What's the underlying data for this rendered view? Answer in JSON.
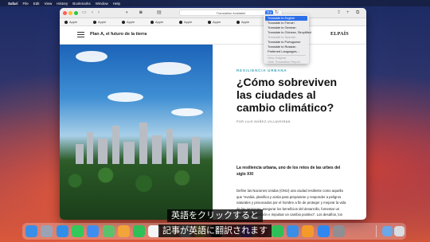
{
  "menubar": {
    "app": "Safari",
    "items": [
      "File",
      "Edit",
      "View",
      "History",
      "Bookmarks",
      "Window",
      "Help"
    ]
  },
  "toolbar": {
    "address": "Translation Available"
  },
  "favorites": [
    {
      "label": "Apple",
      "color": "#222222"
    },
    {
      "label": "Apple",
      "color": "#222222"
    },
    {
      "label": "Apple",
      "color": "#222222"
    },
    {
      "label": "Apple",
      "color": "#222222"
    },
    {
      "label": "Apple",
      "color": "#222222"
    },
    {
      "label": "Apple",
      "color": "#222222"
    },
    {
      "label": "Apple",
      "color": "#222222"
    },
    {
      "label": "Apple",
      "color": "#222222"
    },
    {
      "label": "Apple",
      "color": "#222222"
    }
  ],
  "site": {
    "section_title": "Plan A, el futuro de la tierra",
    "logo": "ELPAÍS"
  },
  "translate_menu": {
    "items": [
      {
        "label": "Translate to English",
        "state": "selected"
      },
      {
        "label": "Translate to French",
        "state": "normal"
      },
      {
        "label": "Translate to German",
        "state": "normal"
      },
      {
        "label": "Translate to Chinese, Simplified",
        "state": "normal"
      },
      {
        "label": "Translate to Spanish",
        "state": "disabled"
      },
      {
        "label": "Translate to Portuguese",
        "state": "normal"
      },
      {
        "label": "Translate to Russian",
        "state": "normal"
      },
      {
        "label": "Preferred Languages…",
        "state": "normal"
      },
      {
        "label": "View Original",
        "state": "disabled"
      },
      {
        "label": "Hide Translation Report",
        "state": "disabled"
      }
    ]
  },
  "article": {
    "kicker": "RESILIENCIA URBANA",
    "headline": "¿Cómo sobreviven las ciudades al cambio climático?",
    "byline": "POR LUIS NÚÑEZ-VILLAVEIRÁN",
    "lead": "La resiliencia urbana, uno de los retos de las urbes del siglo XXI",
    "body": "Define las Naciones Unidas (ONU) una ciudad resiliente como aquella que \"evalúa, planifica y actúa para prepararse y responder a peligros naturales y provocados por el hombre a fin de proteger y mejorar la vida de las personas, asegurar los beneficios del desarrollo, fomentar un entorno de inversión e impulsar un cambio positivo\". Los desafíos, los tenemos a día de hoy muy"
  },
  "subtitles": {
    "line1": "英語をクリックすると",
    "line2": "記事が英語に翻訳されます"
  },
  "dock": [
    {
      "icon": "finder-icon",
      "color": "#3a8ee6"
    },
    {
      "icon": "launchpad-icon",
      "color": "#9aa3b5"
    },
    {
      "icon": "safari-icon",
      "color": "#2f8fe8"
    },
    {
      "icon": "messages-icon",
      "color": "#34c759"
    },
    {
      "icon": "mail-icon",
      "color": "#3d8ef0"
    },
    {
      "icon": "maps-icon",
      "color": "#5cc16c"
    },
    {
      "icon": "photos-icon",
      "color": "#f2a33a"
    },
    {
      "icon": "facetime-icon",
      "color": "#2fbf58"
    },
    {
      "icon": "calendar-icon",
      "color": "#f5f5f5"
    },
    {
      "icon": "contacts-icon",
      "color": "#c9a07a"
    },
    {
      "icon": "reminders-icon",
      "color": "#f0f0f0"
    },
    {
      "icon": "notes-icon",
      "color": "#f7d54a"
    },
    {
      "icon": "tv-icon",
      "color": "#1e1e1e"
    },
    {
      "icon": "music-icon",
      "color": "#f04a5e"
    },
    {
      "icon": "podcasts-icon",
      "color": "#9b4de0"
    },
    {
      "icon": "news-icon",
      "color": "#f04b4b"
    },
    {
      "icon": "numbers-icon",
      "color": "#2fbf58"
    },
    {
      "icon": "keynote-icon",
      "color": "#3a8ee6"
    },
    {
      "icon": "pages-icon",
      "color": "#f39a2b"
    },
    {
      "icon": "appstore-icon",
      "color": "#3187f0"
    },
    {
      "icon": "settings-icon",
      "color": "#8e8e93"
    },
    {
      "icon": "downloads-icon",
      "color": "#6aa8e8"
    },
    {
      "icon": "trash-icon",
      "color": "#d9dde2"
    }
  ]
}
